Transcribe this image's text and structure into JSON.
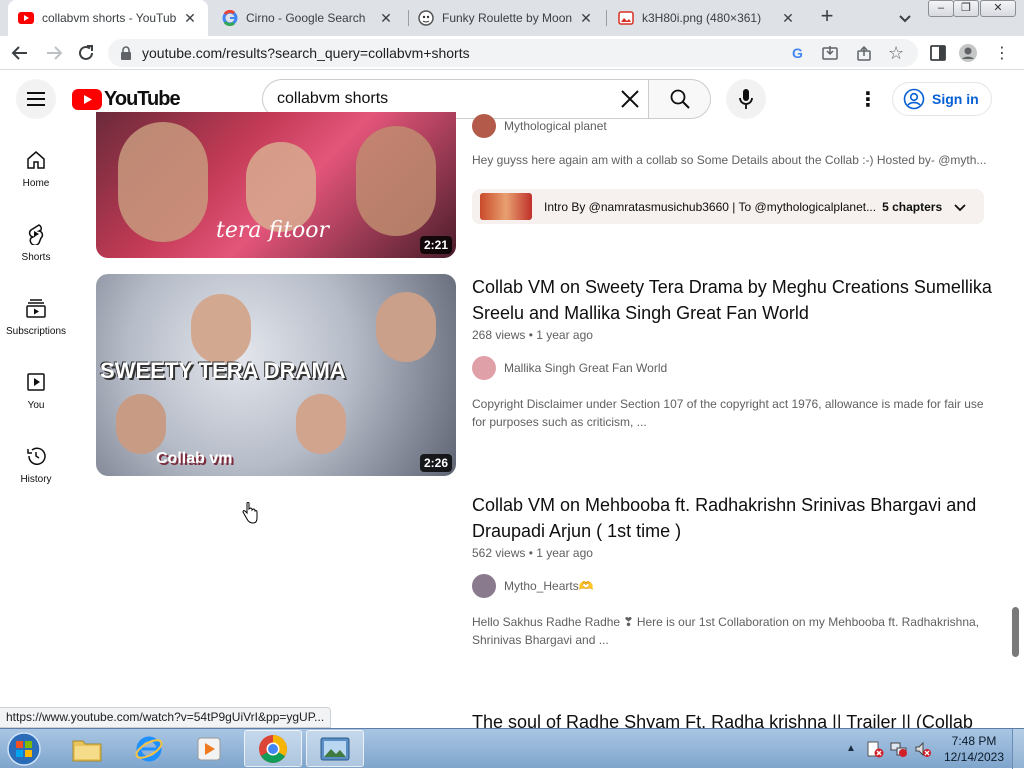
{
  "browser": {
    "tabs": [
      {
        "title": "collabvm shorts - YouTube",
        "favicon": "youtube-favicon",
        "active": true
      },
      {
        "title": "Cirno - Google Search",
        "favicon": "google-favicon",
        "active": false
      },
      {
        "title": "Funky Roulette by MoonG",
        "favicon": "scratch-favicon",
        "active": false
      },
      {
        "title": "k3H80i.png (480×361)",
        "favicon": "image-favicon",
        "active": false
      }
    ],
    "new_tab": "+",
    "url": "youtube.com/results?search_query=collabvm+shorts",
    "status_url": "https://www.youtube.com/watch?v=54tP9gUiVrI&pp=ygUP..."
  },
  "youtube": {
    "logo_text": "YouTube",
    "search": {
      "value": "collabvm shorts",
      "placeholder": "Search"
    },
    "sign_in": "Sign in",
    "sidebar": [
      {
        "label": "Home",
        "icon": "home-icon"
      },
      {
        "label": "Shorts",
        "icon": "shorts-icon"
      },
      {
        "label": "Subscriptions",
        "icon": "subscriptions-icon"
      },
      {
        "label": "You",
        "icon": "you-icon"
      },
      {
        "label": "History",
        "icon": "history-icon"
      }
    ],
    "results": [
      {
        "duration": "2:21",
        "thumb_text": "tera fitoor",
        "channel_partial": "Mythological planet",
        "description": "Hey guyss here again am with a collab so Some Details about the Collab :-) Hosted by- @myth...",
        "chapters": {
          "text": "Intro By @namratasmusichub3660 | To @mythologicalplanet...",
          "count": "5 chapters"
        }
      },
      {
        "duration": "2:26",
        "thumb_text": "SWEETY TERA DRAMA",
        "thumb_subtext": "Collab vm",
        "title": "Collab VM on Sweety Tera Drama by Meghu Creations Sumellika Sreelu and Mallika Singh Great Fan World",
        "meta": "268 views • 1 year ago",
        "channel": "Mallika Singh Great Fan World",
        "description": "Copyright Disclaimer under Section 107 of the copyright act 1976, allowance is made for fair use for purposes such as criticism, ..."
      },
      {
        "title": "Collab VM on Mehbooba ft. Radhakrishn Srinivas Bhargavi and Draupadi Arjun ( 1st time )",
        "meta": "562 views • 1 year ago",
        "channel": "Mytho_Hearts🫶",
        "description": "Hello Sakhus Radhe Radhe ❣ Here is our 1st Collaboration on my Mehbooba ft. Radhakrishna, Shrinivas Bhargavi and ..."
      },
      {
        "title": "The soul of Radhe Shyam Ft. Radha krishna || Trailer || (Collab"
      }
    ]
  },
  "taskbar": {
    "clock_time": "7:48 PM",
    "clock_date": "12/14/2023"
  },
  "colors": {
    "youtube_red": "#ff0000",
    "link_blue": "#065fd4",
    "tab_strip": "#dee1e6",
    "taskbar": "#8fb1d6"
  }
}
